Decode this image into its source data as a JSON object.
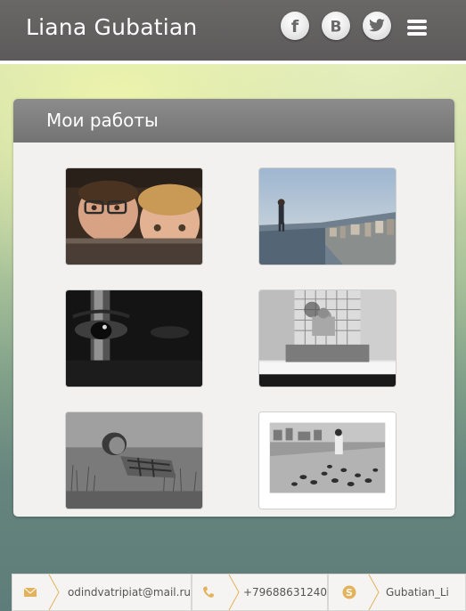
{
  "header": {
    "title": "Liana Gubatian",
    "social": [
      {
        "icon": "facebook-icon",
        "glyph": "f"
      },
      {
        "icon": "vkontakte-icon",
        "glyph": "B"
      },
      {
        "icon": "twitter-icon",
        "glyph": ""
      }
    ],
    "menu_icon": "hamburger-menu-icon"
  },
  "works": {
    "title": "Мои работы",
    "items": [
      {
        "name": "work-thumb-children"
      },
      {
        "name": "work-thumb-rooftop"
      },
      {
        "name": "work-thumb-eye"
      },
      {
        "name": "work-thumb-window"
      },
      {
        "name": "work-thumb-grass"
      },
      {
        "name": "work-thumb-pigeons"
      }
    ]
  },
  "contacts": {
    "email": "odindvatripiat@mail.ru",
    "phone": "+79688631240",
    "skype": "Gubatian_Li",
    "accent_color": "#e3b35c"
  }
}
